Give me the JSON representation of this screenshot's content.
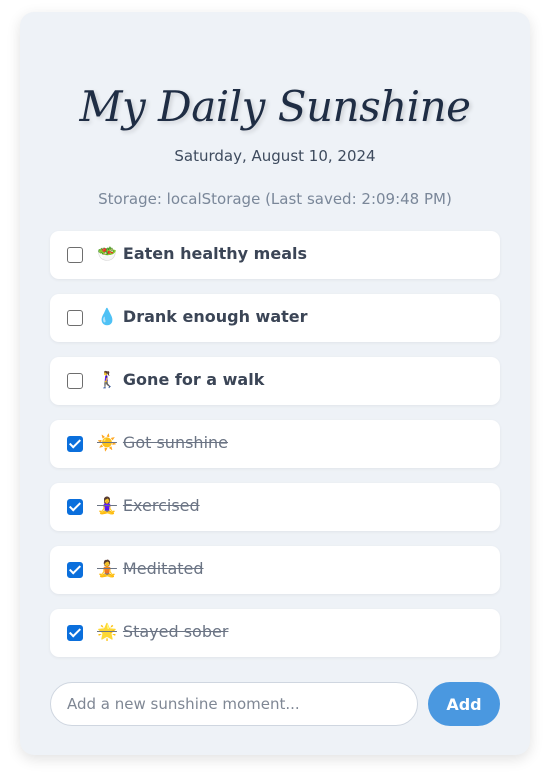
{
  "app": {
    "title": "My Daily Sunshine",
    "date": "Saturday, August 10, 2024",
    "storage_status": "Storage: localStorage (Last saved: 2:09:48 PM)"
  },
  "items": [
    {
      "emoji": "🥗",
      "label": "Eaten healthy meals",
      "checked": false
    },
    {
      "emoji": "💧",
      "label": "Drank enough water",
      "checked": false
    },
    {
      "emoji": "🚶‍♀️",
      "label": "Gone for a walk",
      "checked": false
    },
    {
      "emoji": "☀️",
      "label": "Got sunshine",
      "checked": true
    },
    {
      "emoji": "🧘‍♀️",
      "label": "Exercised",
      "checked": true
    },
    {
      "emoji": "🧘",
      "label": "Meditated",
      "checked": true
    },
    {
      "emoji": "🌟",
      "label": "Stayed sober",
      "checked": true
    }
  ],
  "add": {
    "placeholder": "Add a new sunshine moment...",
    "value": "",
    "button_label": "Add"
  },
  "colors": {
    "card_bg": "#eef2f7",
    "accent": "#4a98e0",
    "checkbox_checked": "#0b6fdc",
    "title": "#1f2d44"
  }
}
